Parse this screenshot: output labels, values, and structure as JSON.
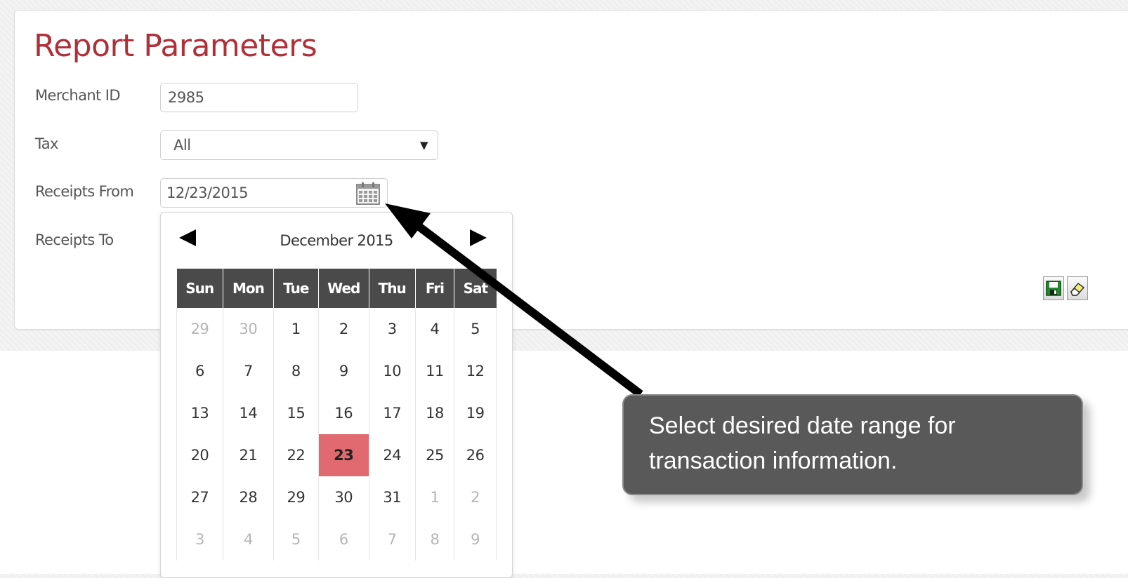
{
  "title": "Report Parameters",
  "form": {
    "merchant_id": {
      "label": "Merchant ID",
      "value": "2985"
    },
    "tax": {
      "label": "Tax",
      "value": "All"
    },
    "receipts_from": {
      "label": "Receipts From",
      "value": "12/23/2015"
    },
    "receipts_to": {
      "label": "Receipts To"
    }
  },
  "datepicker": {
    "month_label": "December 2015",
    "weekdays": [
      "Sun",
      "Mon",
      "Tue",
      "Wed",
      "Thu",
      "Fri",
      "Sat"
    ],
    "weeks": [
      [
        {
          "d": "29",
          "muted": true
        },
        {
          "d": "30",
          "muted": true
        },
        {
          "d": "1"
        },
        {
          "d": "2"
        },
        {
          "d": "3"
        },
        {
          "d": "4"
        },
        {
          "d": "5"
        }
      ],
      [
        {
          "d": "6"
        },
        {
          "d": "7"
        },
        {
          "d": "8"
        },
        {
          "d": "9"
        },
        {
          "d": "10"
        },
        {
          "d": "11"
        },
        {
          "d": "12"
        }
      ],
      [
        {
          "d": "13"
        },
        {
          "d": "14"
        },
        {
          "d": "15"
        },
        {
          "d": "16"
        },
        {
          "d": "17"
        },
        {
          "d": "18"
        },
        {
          "d": "19"
        }
      ],
      [
        {
          "d": "20"
        },
        {
          "d": "21"
        },
        {
          "d": "22"
        },
        {
          "d": "23",
          "selected": true
        },
        {
          "d": "24"
        },
        {
          "d": "25"
        },
        {
          "d": "26"
        }
      ],
      [
        {
          "d": "27"
        },
        {
          "d": "28"
        },
        {
          "d": "29"
        },
        {
          "d": "30"
        },
        {
          "d": "31"
        },
        {
          "d": "1",
          "muted": true
        },
        {
          "d": "2",
          "muted": true
        }
      ],
      [
        {
          "d": "3",
          "muted": true
        },
        {
          "d": "4",
          "muted": true
        },
        {
          "d": "5",
          "muted": true
        },
        {
          "d": "6",
          "muted": true
        },
        {
          "d": "7",
          "muted": true
        },
        {
          "d": "8",
          "muted": true
        },
        {
          "d": "9",
          "muted": true
        }
      ]
    ]
  },
  "toolbar": {
    "icons": [
      "save-icon",
      "clear-icon"
    ]
  },
  "callout": {
    "text": "Select desired date range for transaction information."
  },
  "colors": {
    "title": "#b0303a",
    "selected_day": "#e06a6f",
    "weekday_header": "#4a4a4a",
    "callout_bg": "#595959"
  }
}
